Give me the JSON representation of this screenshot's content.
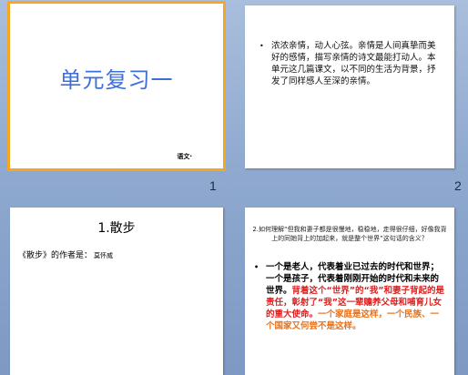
{
  "slides": [
    {
      "number": "1",
      "title": "单元复习一",
      "footer": "语文·"
    },
    {
      "number": "2",
      "bullet": "•",
      "text": "浓浓亲情，动人心弦。亲情是人间真挚而美好的感情，描写亲情的诗文最能打动人。本单元这几篇课文，以不同的生活为背景，抒发了同样感人至深的亲情。"
    },
    {
      "title": "1.散步",
      "author_label": "《散步》的作者是：",
      "author_name": "莫怀威"
    },
    {
      "question": "2.如何理解“但我和妻子都是很慢地，稳稳地，走得很仔细，好像我背上的同她背上的加起来，就是整个世界”这句话的含义？",
      "bullet": "•",
      "answer_black": "一个是老人，代表着业已过去的时代和世界；一个是孩子，代表着刚刚开始的时代和未来的世界。",
      "answer_red": "背着这个“世界”的“我”和妻子背起的是责任，彰射了“我”这一辈赡养父母和哺育儿女的重大使命。",
      "answer_orange": "一个家庭是这样，一个民族、一个国家又何尝不是这样。"
    }
  ],
  "colors": {
    "selection_border": "#f5a623",
    "title_blue": "#3d6fd6",
    "answer_red": "#e02020",
    "answer_orange": "#e8721c"
  }
}
